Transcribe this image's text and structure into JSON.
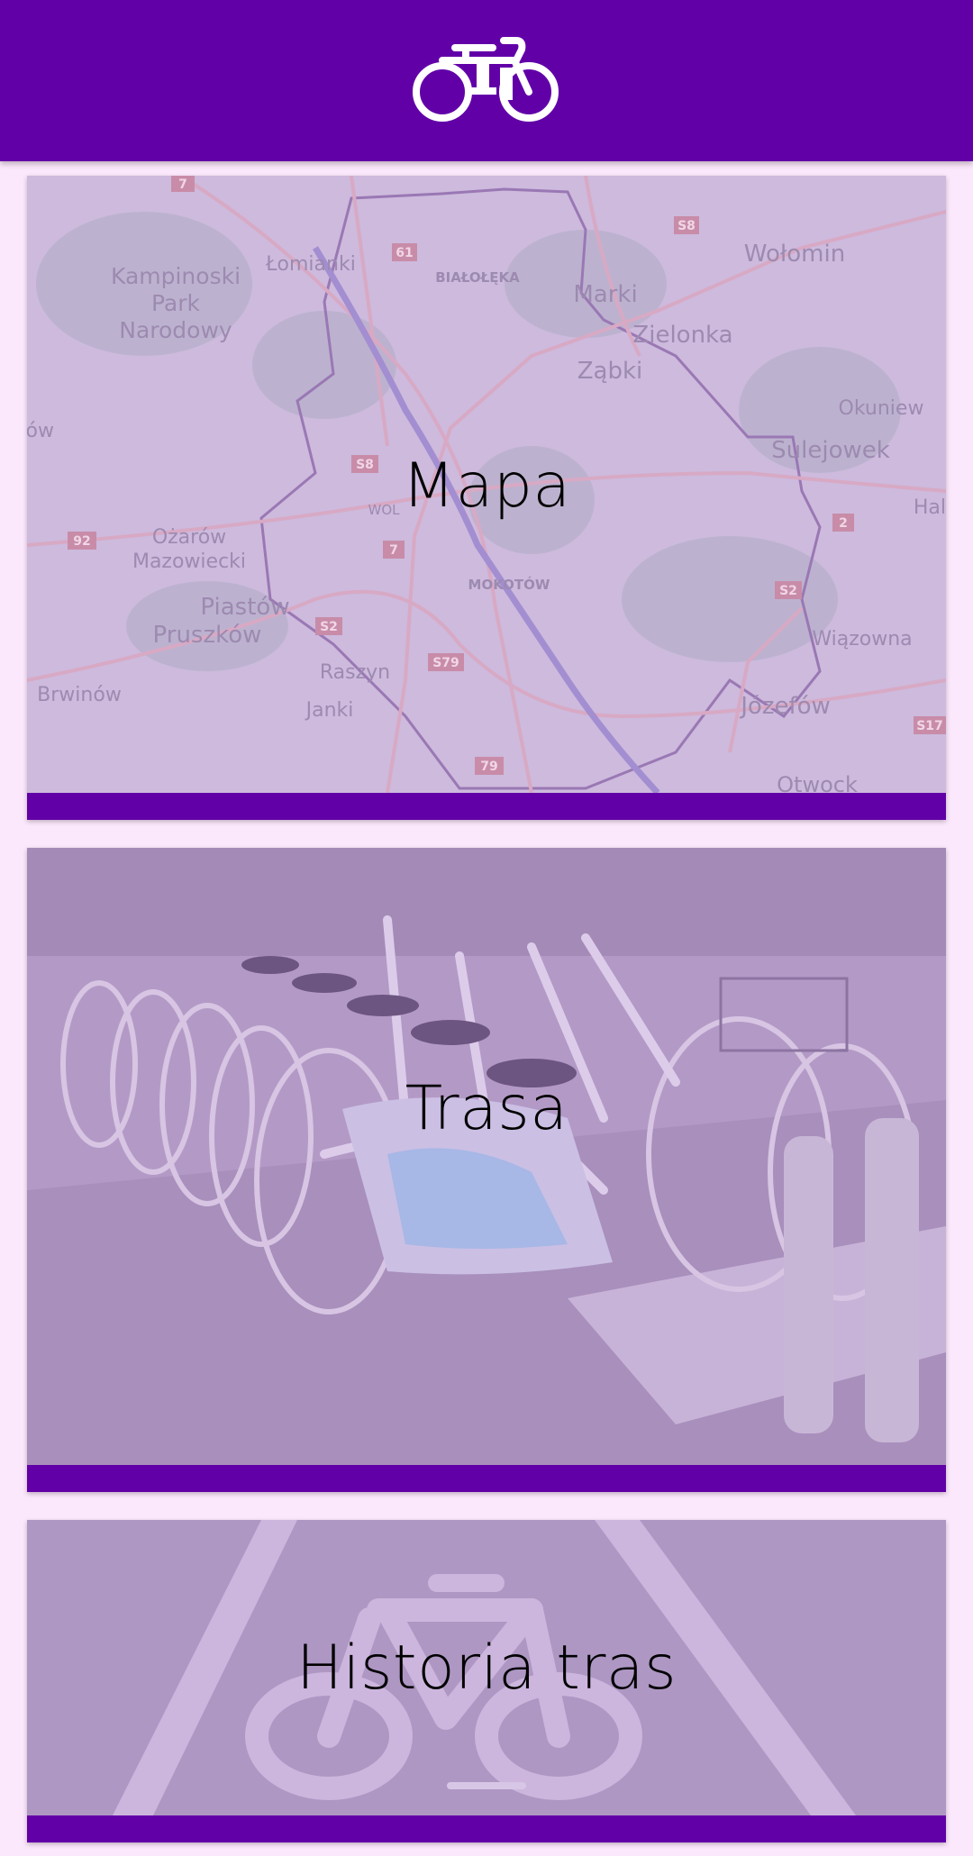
{
  "header": {
    "logo_icon": "bicycle-icon",
    "background_color": "#6200a8"
  },
  "cards": [
    {
      "id": "mapa",
      "label": "Mapa",
      "image": "warsaw-map"
    },
    {
      "id": "trasa",
      "label": "Trasa",
      "image": "city-bike-rack"
    },
    {
      "id": "historia",
      "label": "Historia tras",
      "image": "bike-lane-marking"
    }
  ],
  "colors": {
    "accent": "#6200a8",
    "page_background": "#fce8fc",
    "card_overlay": "#cbb6dc",
    "label_text": "#000000"
  },
  "map_places": [
    "Kampinoski\nPark\nNarodowy",
    "Łomianki",
    "BIAŁOŁĘKA",
    "Marki",
    "Wołomin",
    "Zielonka",
    "Ząbki",
    "Okuniew",
    "Sulejowek",
    "Ożarów\nMazowiecki",
    "Piastów",
    "Pruszków",
    "MOKOTÓW",
    "Raszyn",
    "Janki",
    "Brwinów",
    "Józefów",
    "Wiązowna",
    "Otwock"
  ]
}
